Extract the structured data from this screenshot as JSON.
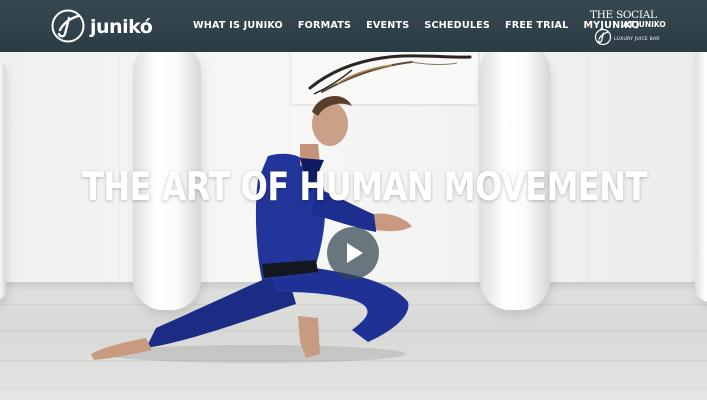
{
  "brand": {
    "name": "junikó",
    "logo_icon": "juniko-j-icon",
    "colors": {
      "navbar": "#2f4049",
      "text": "#ffffff",
      "uniform": "#1e2f8a"
    }
  },
  "nav": {
    "items": [
      {
        "label": "WHAT IS JUNIKO"
      },
      {
        "label": "FORMATS"
      },
      {
        "label": "EVENTS"
      },
      {
        "label": "SCHEDULES"
      },
      {
        "label": "FREE TRIAL"
      },
      {
        "label": "MYJUNIKO"
      }
    ]
  },
  "social_logo": {
    "title": "THE SOCIAL",
    "at": "AT JUNIKO",
    "subtitle": "LUXURY JUICE BAR"
  },
  "hero": {
    "headline": "THE ART OF HUMAN MOVEMENT",
    "play_icon": "play-icon"
  }
}
